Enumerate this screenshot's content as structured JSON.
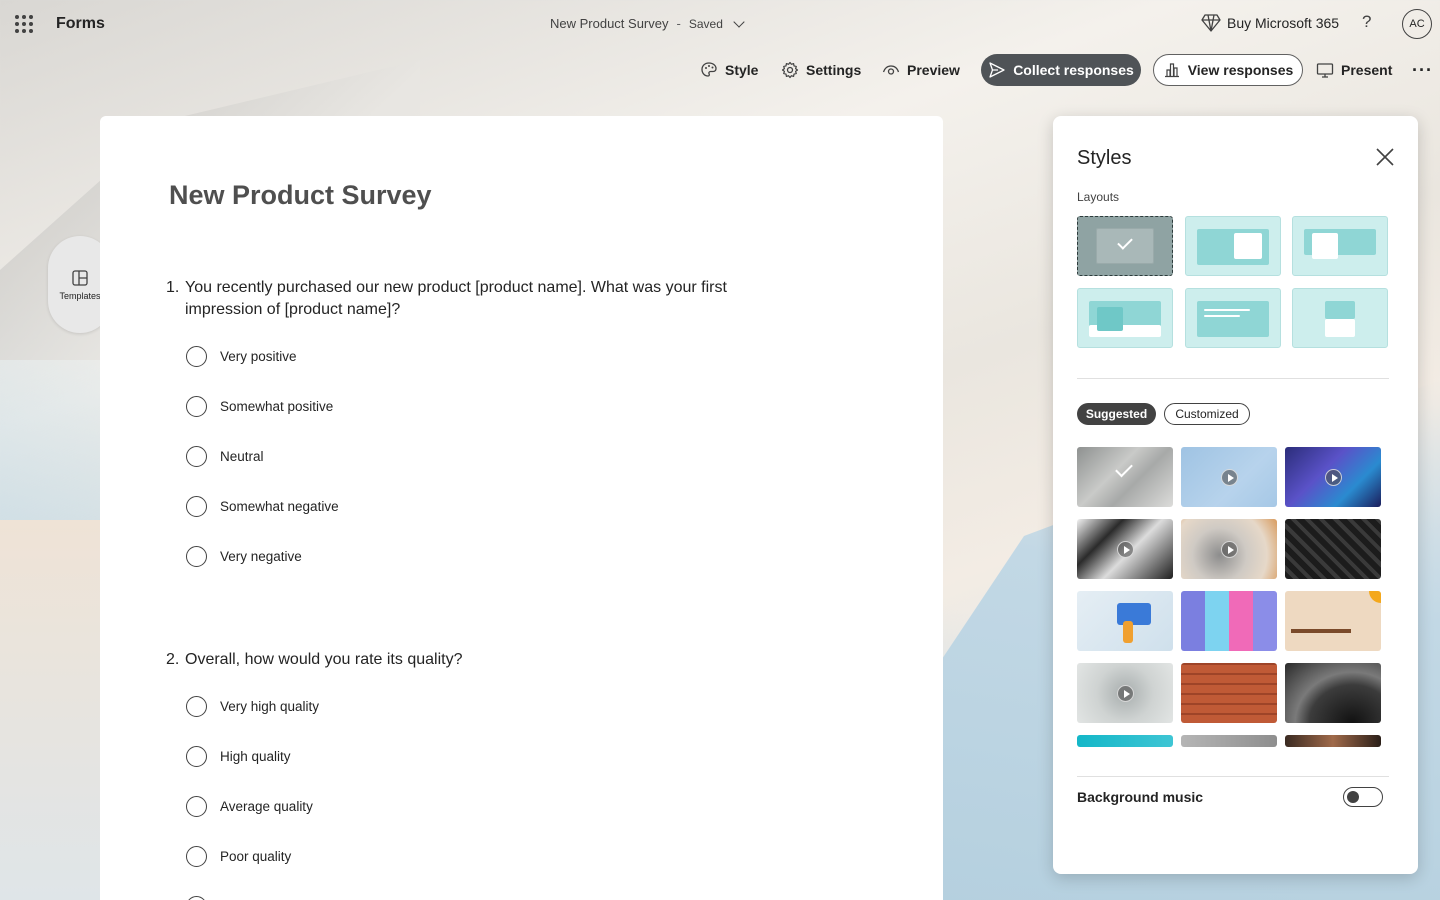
{
  "app": {
    "name": "Forms"
  },
  "header": {
    "doc_title": "New Product Survey",
    "separator": "-",
    "save_status": "Saved",
    "buy_label": "Buy Microsoft 365",
    "help_label": "?",
    "avatar_initials": "AC"
  },
  "toolbar": {
    "style_label": "Style",
    "settings_label": "Settings",
    "preview_label": "Preview",
    "collect_label": "Collect responses",
    "view_responses_label": "View responses",
    "present_label": "Present",
    "more_label": "···"
  },
  "sidebar": {
    "templates_label": "Templates"
  },
  "form": {
    "title": "New Product Survey",
    "questions": [
      {
        "number": "1.",
        "text": "You recently purchased our new product [product name]. What was your first impression of [product name]?",
        "options": [
          "Very positive",
          "Somewhat positive",
          "Neutral",
          "Somewhat negative",
          "Very negative"
        ]
      },
      {
        "number": "2.",
        "text": "Overall, how would you rate its quality?",
        "options": [
          "Very high quality",
          "High quality",
          "Average quality",
          "Poor quality"
        ]
      }
    ]
  },
  "styles_panel": {
    "title": "Styles",
    "layouts_label": "Layouts",
    "selected_layout": 1,
    "tab_suggested": "Suggested",
    "tab_customized": "Customized",
    "active_tab": "Suggested",
    "background_music_label": "Background music",
    "background_music_on": false
  },
  "colors": {
    "collect_button_bg": "#4f5357",
    "layout_tile": "#cdeeed",
    "layout_accent": "#8fd6d5",
    "selected_layout": "#8fa3a3"
  },
  "icons": [
    "waffle-icon",
    "diamond-icon",
    "palette-icon",
    "gear-icon",
    "eye-icon",
    "send-icon",
    "chart-icon",
    "monitor-icon",
    "templates-icon",
    "close-icon",
    "chevron-down-icon",
    "play-icon",
    "check-icon"
  ]
}
